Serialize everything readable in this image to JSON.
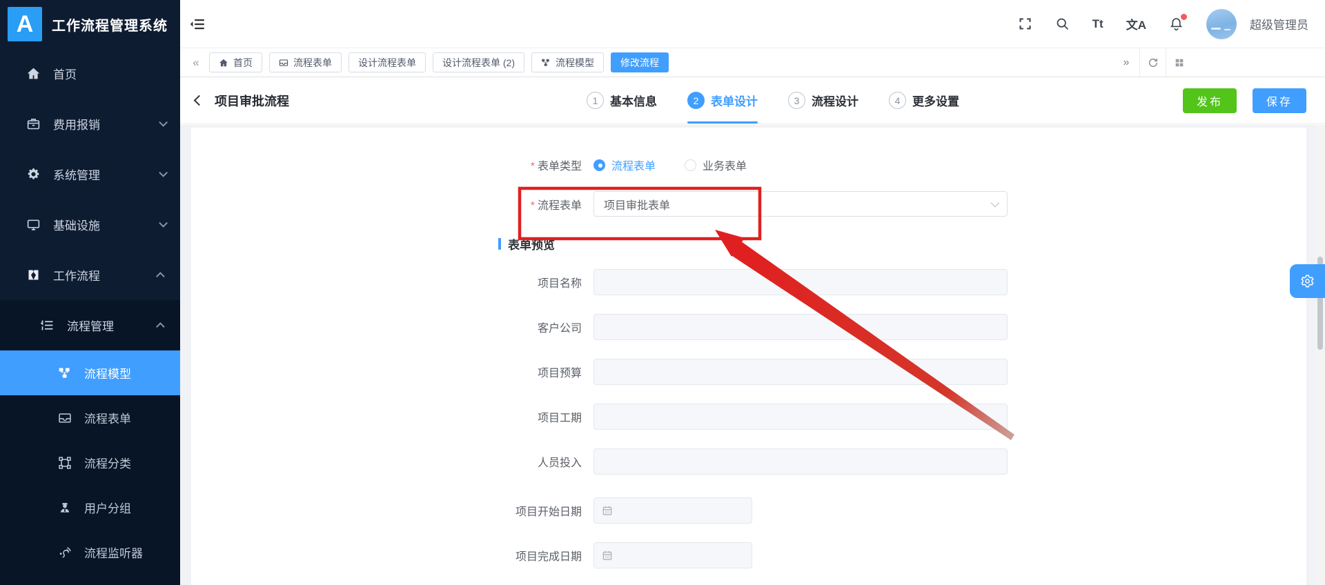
{
  "app": {
    "logo_letter": "A",
    "title": "工作流程管理系统"
  },
  "topbar": {
    "username": "超级管理员",
    "font_icon_glyph": "Tt",
    "translate_icon_glyph": "文A",
    "notification_badge_color": "#f05b5b"
  },
  "tagbar": {
    "scroll_left_glyph": "«",
    "scroll_right_glyph": "»",
    "tabs": [
      {
        "label": "首页",
        "icon": "home-icon",
        "active": false
      },
      {
        "label": "流程表单",
        "icon": "drawer-icon",
        "active": false
      },
      {
        "label": "设计流程表单",
        "icon": null,
        "active": false
      },
      {
        "label": "设计流程表单 (2)",
        "icon": null,
        "active": false
      },
      {
        "label": "流程模型",
        "icon": "model-icon",
        "active": false
      },
      {
        "label": "修改流程",
        "icon": null,
        "active": true
      }
    ]
  },
  "page": {
    "title": "项目审批流程",
    "steps": [
      {
        "num": "1",
        "label": "基本信息",
        "active": false
      },
      {
        "num": "2",
        "label": "表单设计",
        "active": true
      },
      {
        "num": "3",
        "label": "流程设计",
        "active": false
      },
      {
        "num": "4",
        "label": "更多设置",
        "active": false
      }
    ],
    "publish_label": "发布",
    "save_label": "保存"
  },
  "form": {
    "required_mark": "*",
    "type_label": "表单类型",
    "type_options": [
      {
        "label": "流程表单",
        "selected": true
      },
      {
        "label": "业务表单",
        "selected": false
      }
    ],
    "select_label": "流程表单",
    "select_value": "项目审批表单",
    "preview_title": "表单预览",
    "preview_fields": [
      {
        "label": "项目名称",
        "type": "text"
      },
      {
        "label": "客户公司",
        "type": "text"
      },
      {
        "label": "项目预算",
        "type": "text"
      },
      {
        "label": "项目工期",
        "type": "text"
      },
      {
        "label": "人员投入",
        "type": "text"
      },
      {
        "label": "项目开始日期",
        "type": "date"
      },
      {
        "label": "项目完成日期",
        "type": "date"
      }
    ]
  },
  "sidebar": {
    "items": [
      {
        "label": "首页",
        "icon": "home-icon",
        "expandable": false
      },
      {
        "label": "费用报销",
        "icon": "expense-icon",
        "expandable": true,
        "expanded": false
      },
      {
        "label": "系统管理",
        "icon": "gear-icon",
        "expandable": true,
        "expanded": false
      },
      {
        "label": "基础设施",
        "icon": "monitor-icon",
        "expandable": true,
        "expanded": false
      },
      {
        "label": "工作流程",
        "icon": "workflow-icon",
        "expandable": true,
        "expanded": true
      }
    ],
    "submenu": {
      "label": "流程管理",
      "icon": "list-icon",
      "expanded": true,
      "children": [
        {
          "label": "流程模型",
          "icon": "model-icon",
          "active": true
        },
        {
          "label": "流程表单",
          "icon": "drawer-icon",
          "active": false
        },
        {
          "label": "流程分类",
          "icon": "category-icon",
          "active": false
        },
        {
          "label": "用户分组",
          "icon": "user-group-icon",
          "active": false
        },
        {
          "label": "流程监听器",
          "icon": "listener-icon",
          "active": false
        }
      ]
    }
  },
  "colors": {
    "primary": "#409eff",
    "success": "#52c41a",
    "sidebar_bg": "#0e1c32",
    "submenu_bg": "#081527",
    "annotation_red": "#e02020",
    "page_bg": "#f0f2f5"
  }
}
